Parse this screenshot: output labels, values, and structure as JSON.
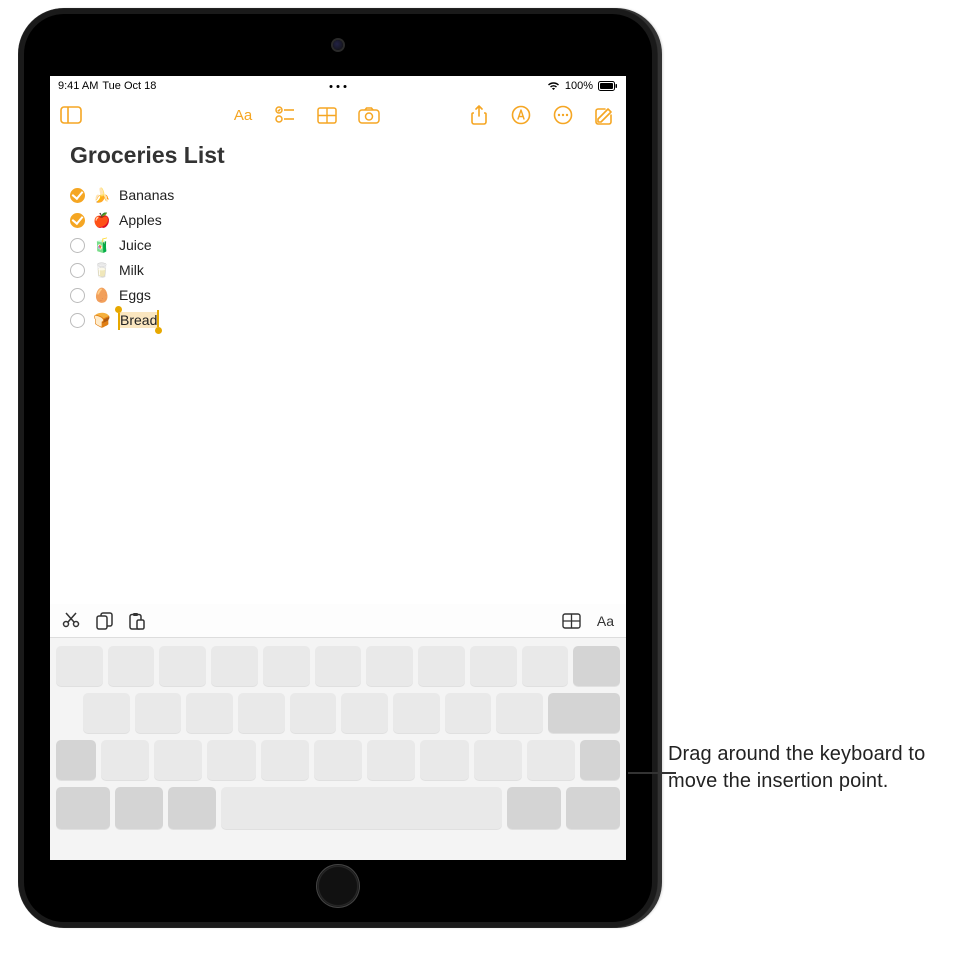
{
  "statusbar": {
    "time": "9:41 AM",
    "date": "Tue Oct 18",
    "battery_text": "100%"
  },
  "toolbar": {
    "sidebar_icon": "sidebar",
    "format_icon": "Aa",
    "checklist_icon": "checklist",
    "table_icon": "table",
    "camera_icon": "camera",
    "share_icon": "share",
    "markup_icon": "markup",
    "more_icon": "more",
    "compose_icon": "compose"
  },
  "note": {
    "title": "Groceries List",
    "items": [
      {
        "checked": true,
        "emoji": "🍌",
        "text": "Bananas"
      },
      {
        "checked": true,
        "emoji": "🍎",
        "text": "Apples"
      },
      {
        "checked": false,
        "emoji": "🧃",
        "text": "Juice"
      },
      {
        "checked": false,
        "emoji": "🥛",
        "text": "Milk"
      },
      {
        "checked": false,
        "emoji": "🥚",
        "text": "Eggs"
      },
      {
        "checked": false,
        "emoji": "🍞",
        "text": "Bread",
        "selected": true
      }
    ]
  },
  "keyboard_toolbar": {
    "cut_icon": "cut",
    "copy_icon": "copy",
    "paste_icon": "paste",
    "table_icon": "table",
    "format_icon": "Aa"
  },
  "callout": {
    "text": "Drag around the keyboard to move the insertion point."
  }
}
